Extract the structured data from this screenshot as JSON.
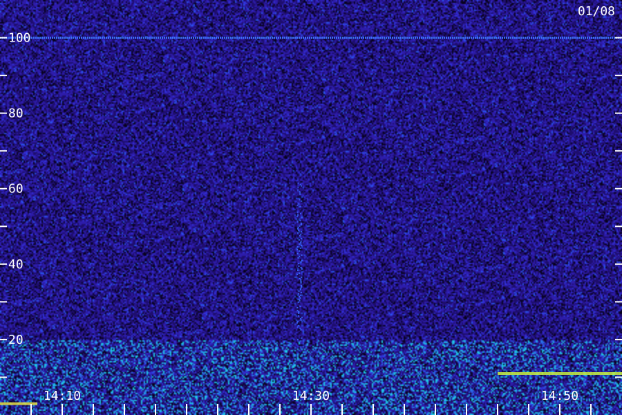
{
  "chart_data": {
    "type": "heatmap",
    "title": "",
    "xlabel": "",
    "ylabel": "",
    "date_label": "01/08",
    "x_range": [
      "14:05",
      "14:55"
    ],
    "x_tick_labels": [
      "14:10",
      "14:30",
      "14:50"
    ],
    "x_minor_tick_minutes": 2.5,
    "ylim": [
      0,
      110
    ],
    "y_tick_labels": [
      "20",
      "40",
      "60",
      "80",
      "100"
    ],
    "y_minor_ticks": [
      10,
      30,
      50,
      70,
      90
    ],
    "noise_floor_color": "#2a1aa8",
    "features": [
      {
        "kind": "horizontal-line",
        "y": 100,
        "from": "14:05",
        "to": "14:55",
        "color": "#3f7bff"
      },
      {
        "kind": "vertical-trace",
        "time": "14:29",
        "y_from": 20,
        "y_to": 62,
        "peak_y": 38,
        "color": "#3b6cff"
      },
      {
        "kind": "low-band-noise",
        "y_from": 0,
        "y_to": 20,
        "color": "#40e0ff"
      },
      {
        "kind": "bright-band",
        "y": 3,
        "from": "14:05",
        "to": "14:08",
        "color": "#e8e040"
      },
      {
        "kind": "bright-band",
        "y": 11,
        "from": "14:45",
        "to": "14:55",
        "color": "#c8f040"
      }
    ],
    "colors": {
      "background": "#14063f",
      "noise_low": "#1a0a5c",
      "noise_high": "#3a2ad8",
      "axis_ticks": "#ffffff"
    }
  }
}
